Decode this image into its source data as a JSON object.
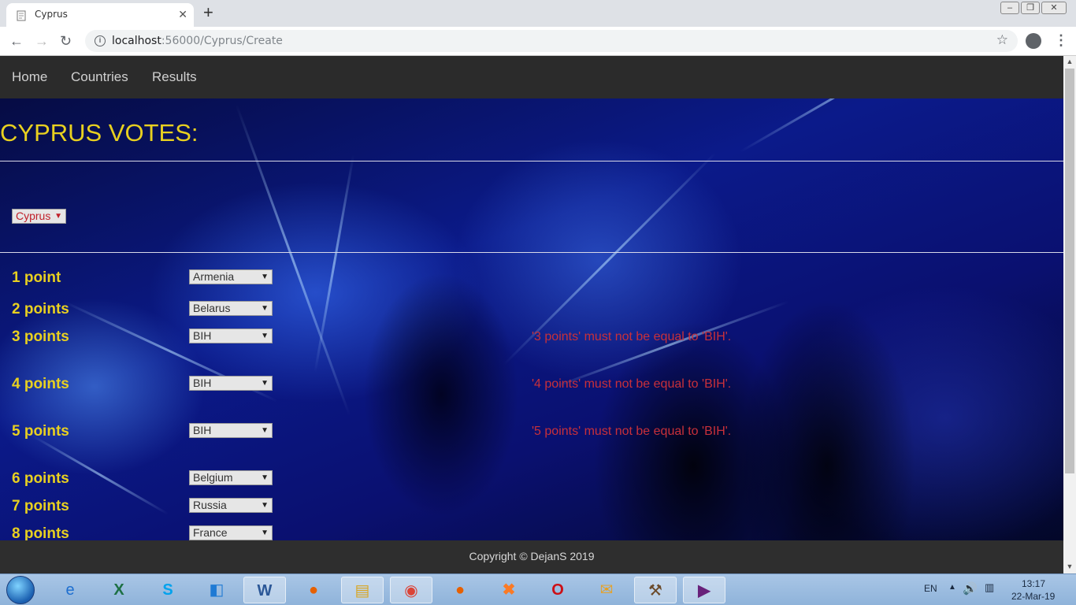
{
  "browser": {
    "tab_title": "Cyprus",
    "tab_close": "✕",
    "new_tab": "+",
    "url_host": "localhost",
    "url_path": ":56000/Cyprus/Create",
    "win_min": "–",
    "win_max": "❐",
    "win_close": "✕"
  },
  "nav": {
    "home": "Home",
    "countries": "Countries",
    "results": "Results"
  },
  "page": {
    "title": "CYPRUS VOTES:",
    "country_select": "Cyprus"
  },
  "votes": [
    {
      "label": "1 point",
      "value": "Armenia",
      "error": ""
    },
    {
      "label": "2 points",
      "value": "Belarus",
      "error": ""
    },
    {
      "label": "3 points",
      "value": "BIH",
      "error": "'3 points' must not be equal to 'BIH'."
    },
    {
      "label": "4 points",
      "value": "BIH",
      "error": "'4 points' must not be equal to 'BIH'."
    },
    {
      "label": "5 points",
      "value": "BIH",
      "error": "'5 points' must not be equal to 'BIH'."
    },
    {
      "label": "6 points",
      "value": "Belgium",
      "error": ""
    },
    {
      "label": "7 points",
      "value": "Russia",
      "error": ""
    },
    {
      "label": "8 points",
      "value": "France",
      "error": ""
    }
  ],
  "footer": {
    "copyright": "Copyright © DejanS 2019"
  },
  "taskbar": {
    "lang": "EN",
    "time": "13:17",
    "date": "22-Mar-19"
  },
  "colors": {
    "title": "#e8d020",
    "error": "#c8303a",
    "navbar": "#2b2b2b"
  }
}
